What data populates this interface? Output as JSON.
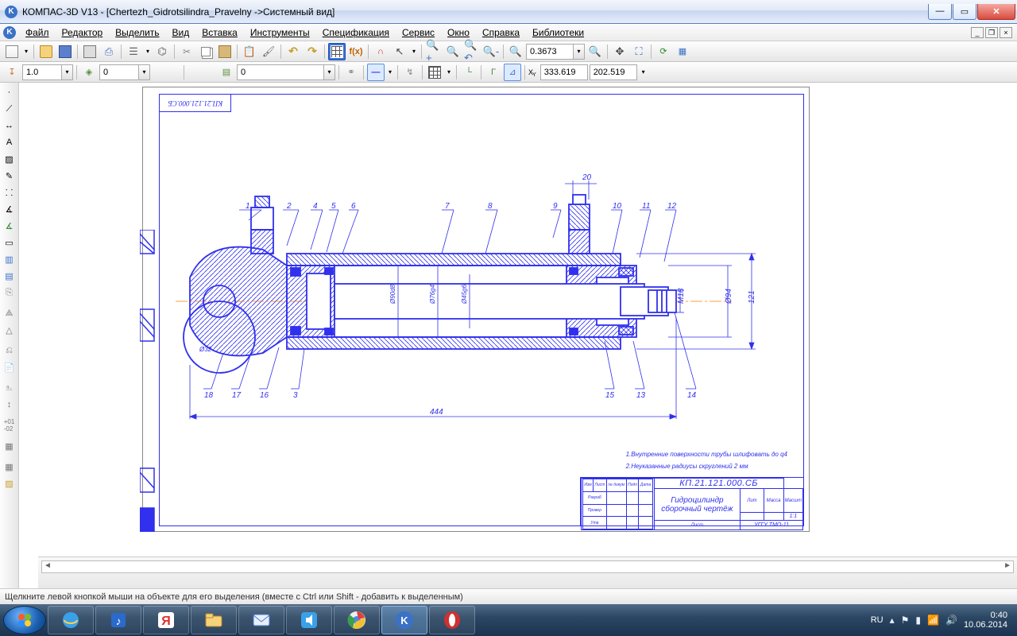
{
  "title": "КОМПАС-3D V13 - [Chertezh_Gidrotsilindra_Pravelny ->Системный вид]",
  "menu": {
    "items": [
      "Файл",
      "Редактор",
      "Выделить",
      "Вид",
      "Вставка",
      "Инструменты",
      "Спецификация",
      "Сервис",
      "Окно",
      "Справка",
      "Библиотеки"
    ]
  },
  "toolbar1": {
    "zoom_value": "0.3673"
  },
  "toolbar2": {
    "val_a": "1.0",
    "val_b": "0",
    "val_c": "0",
    "coord_x": "333.619",
    "coord_y": "202.519",
    "coord_x_label": "X",
    "coord_y_label": "Y"
  },
  "drawing": {
    "designation": "КП.21.121.000.СБ",
    "stamp_rot": "КП.21.121.000.СБ",
    "name_line1": "Гидроцилиндр",
    "name_line2": "сборочный чертёж",
    "org": "УГГУ  ТМО-11",
    "sheet_count": "1:1",
    "note1": "1.Внутренние поверхности трубы шлифовать до q4",
    "note2": "2.Неуказанные радиусы скруглений 2 мм",
    "dim_len": "444",
    "dim_h1": "121",
    "dim_h2": "Ø94",
    "dim_h3": "М18",
    "dim_top": "20",
    "dim_d1": "Ø90d8",
    "dim_d2": "Ø76g4",
    "dim_d3": "Ø45g6",
    "dim_d0": "Ø32",
    "pos": {
      "1": "1",
      "2": "2",
      "3": "3",
      "4": "4",
      "5": "5",
      "6": "6",
      "7": "7",
      "8": "8",
      "9": "9",
      "10": "10",
      "11": "11",
      "12": "12",
      "13": "13",
      "14": "14",
      "15": "15",
      "16": "16",
      "17": "17",
      "18": "18"
    }
  },
  "status": "Щелкните левой кнопкой мыши на объекте для его выделения (вместе с Ctrl или Shift - добавить к выделенным)",
  "systray": {
    "lang": "RU",
    "time": "0:40",
    "date": "10.06.2014"
  }
}
